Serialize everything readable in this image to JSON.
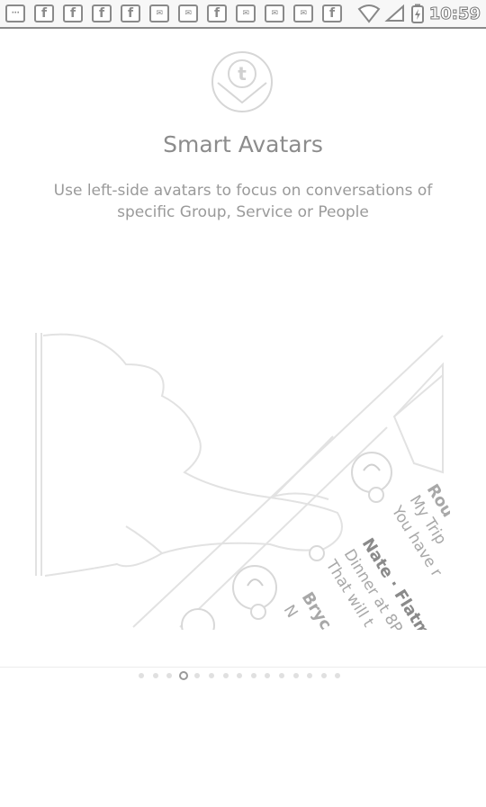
{
  "status_bar": {
    "time": "10:59",
    "notification_icons": [
      "more-icon",
      "facebook-icon",
      "facebook-icon",
      "facebook-icon",
      "facebook-icon",
      "email-icon",
      "email-icon",
      "facebook-icon",
      "email-icon",
      "email-icon",
      "email-icon",
      "facebook-icon"
    ],
    "icon_glyph_facebook": "f",
    "icon_glyph_email": "✉",
    "icon_glyph_more": "···"
  },
  "onboarding": {
    "title": "Smart Avatars",
    "subtitle": "Use left-side avatars to focus on conversations of specific Group, Service or People",
    "illustration_texts": {
      "row1_name": "Rou",
      "row1_line1": "My Trip",
      "row1_line2": "You have r",
      "row2_name": "Nate · Flatmat",
      "row2_line1": "Dinner at 8P",
      "row2_line2": "That will t",
      "row3_name": "Bryc",
      "row3_line1": "N"
    }
  },
  "pager": {
    "total_pages": 15,
    "active_page": 4
  },
  "colors": {
    "line": "#d9d9d9",
    "text": "#8c8c8c",
    "status_border": "#8a8a8a"
  }
}
